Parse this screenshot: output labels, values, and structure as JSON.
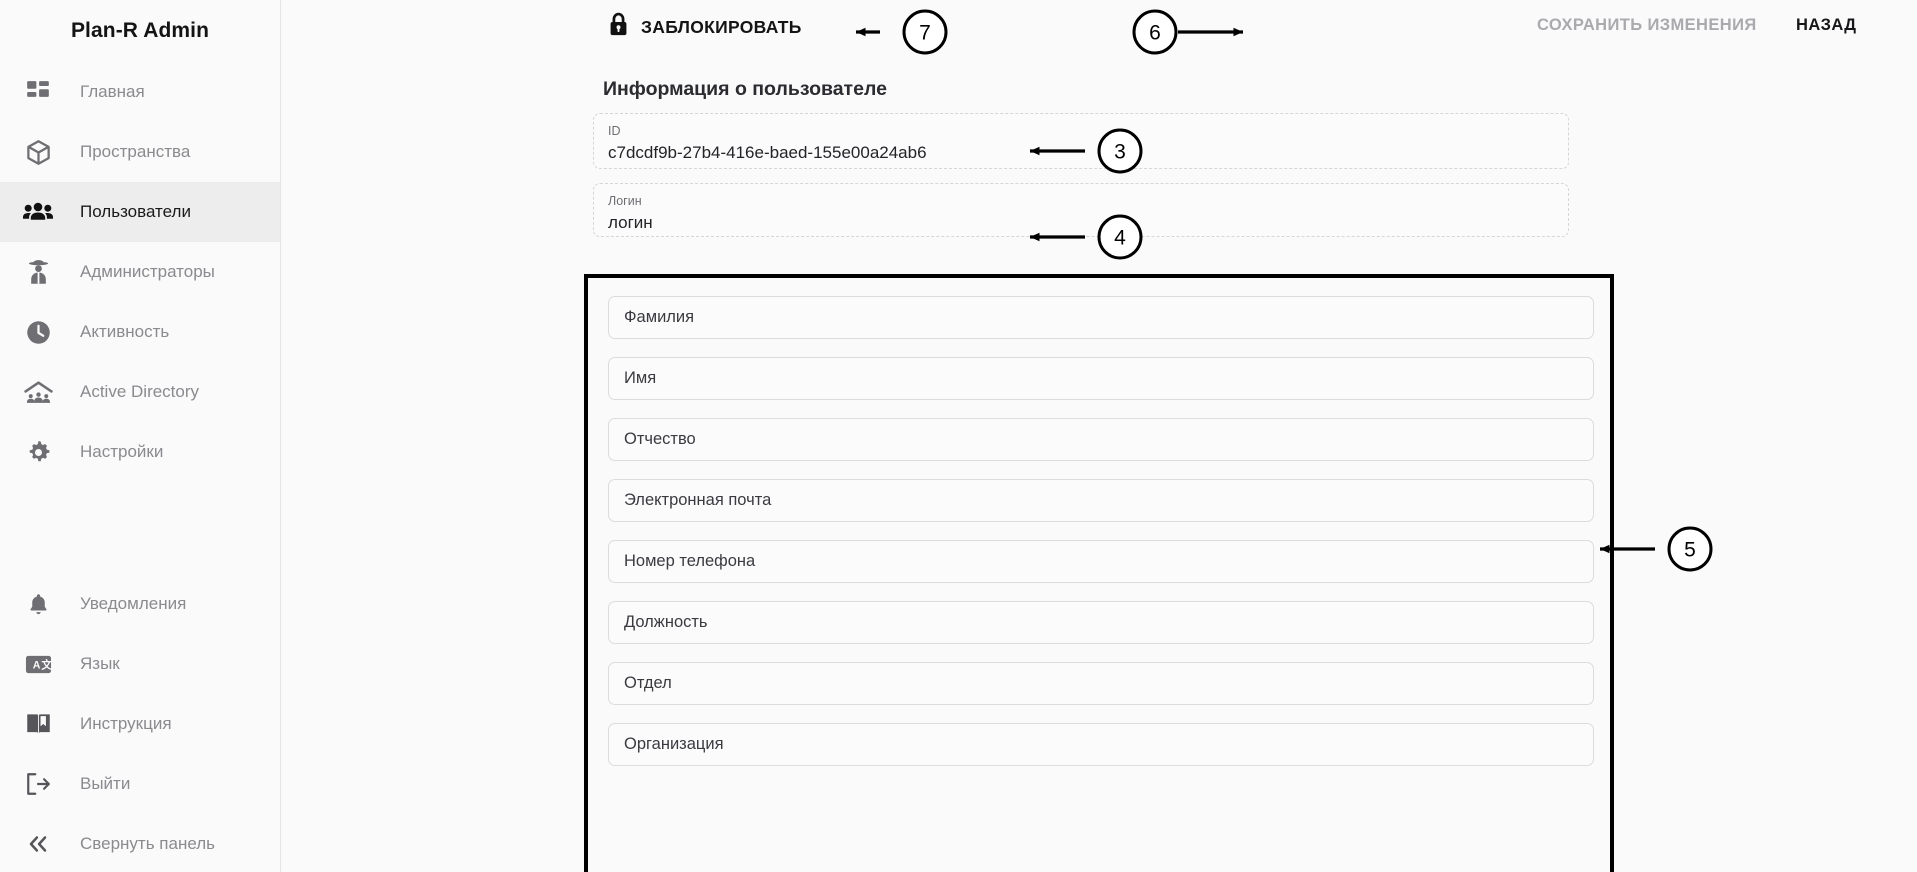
{
  "sidebar": {
    "brand": "Plan-R Admin",
    "items": [
      {
        "label": "Главная",
        "icon": "dashboard-icon",
        "active": false
      },
      {
        "label": "Пространства",
        "icon": "cube-icon",
        "active": false
      },
      {
        "label": "Пользователи",
        "icon": "users-icon",
        "active": true
      },
      {
        "label": "Администраторы",
        "icon": "admin-detective-icon",
        "active": false
      },
      {
        "label": "Активность",
        "icon": "clock-icon",
        "active": false
      },
      {
        "label": "Active Directory",
        "icon": "active-directory-icon",
        "active": false
      },
      {
        "label": "Настройки",
        "icon": "gear-icon",
        "active": false
      }
    ],
    "bottom_items": [
      {
        "label": "Уведомления",
        "icon": "bell-icon"
      },
      {
        "label": "Язык",
        "icon": "translate-icon"
      },
      {
        "label": "Инструкция",
        "icon": "book-icon"
      },
      {
        "label": "Выйти",
        "icon": "logout-icon"
      },
      {
        "label": "Свернуть панель",
        "icon": "chevron-double-left-icon"
      }
    ]
  },
  "toolbar": {
    "lock_label": "ЗАБЛОКИРОВАТЬ",
    "lock_icon": "lock-icon",
    "save_label": "СОХРАНИТЬ ИЗМЕНЕНИЯ",
    "back_label": "НАЗАД"
  },
  "main": {
    "section_title": "Информация о пользователе",
    "id_field": {
      "caption": "ID",
      "value": "c7dcdf9b-27b4-416e-baed-155e00a24ab6"
    },
    "login_field": {
      "caption": "Логин",
      "value": "логин"
    },
    "profile_fields": [
      {
        "placeholder": "Фамилия",
        "value": ""
      },
      {
        "placeholder": "Имя",
        "value": ""
      },
      {
        "placeholder": "Отчество",
        "value": ""
      },
      {
        "placeholder": "Электронная почта",
        "value": ""
      },
      {
        "placeholder": "Номер телефона",
        "value": ""
      },
      {
        "placeholder": "Должность",
        "value": ""
      },
      {
        "placeholder": "Отдел",
        "value": ""
      },
      {
        "placeholder": "Организация",
        "value": ""
      }
    ]
  },
  "annotations": [
    {
      "number": "3",
      "target": "id-field"
    },
    {
      "number": "4",
      "target": "login-field"
    },
    {
      "number": "5",
      "target": "profile-fields-group"
    },
    {
      "number": "6",
      "target": "save-changes-button"
    },
    {
      "number": "7",
      "target": "lock-button"
    }
  ],
  "colors": {
    "page_background": "#fafafa",
    "sidebar_active": "#ededed",
    "text_primary": "#17171a",
    "text_muted": "#8a8a8f",
    "disabled_action": "#aaaaae",
    "annotation": "#000000"
  }
}
